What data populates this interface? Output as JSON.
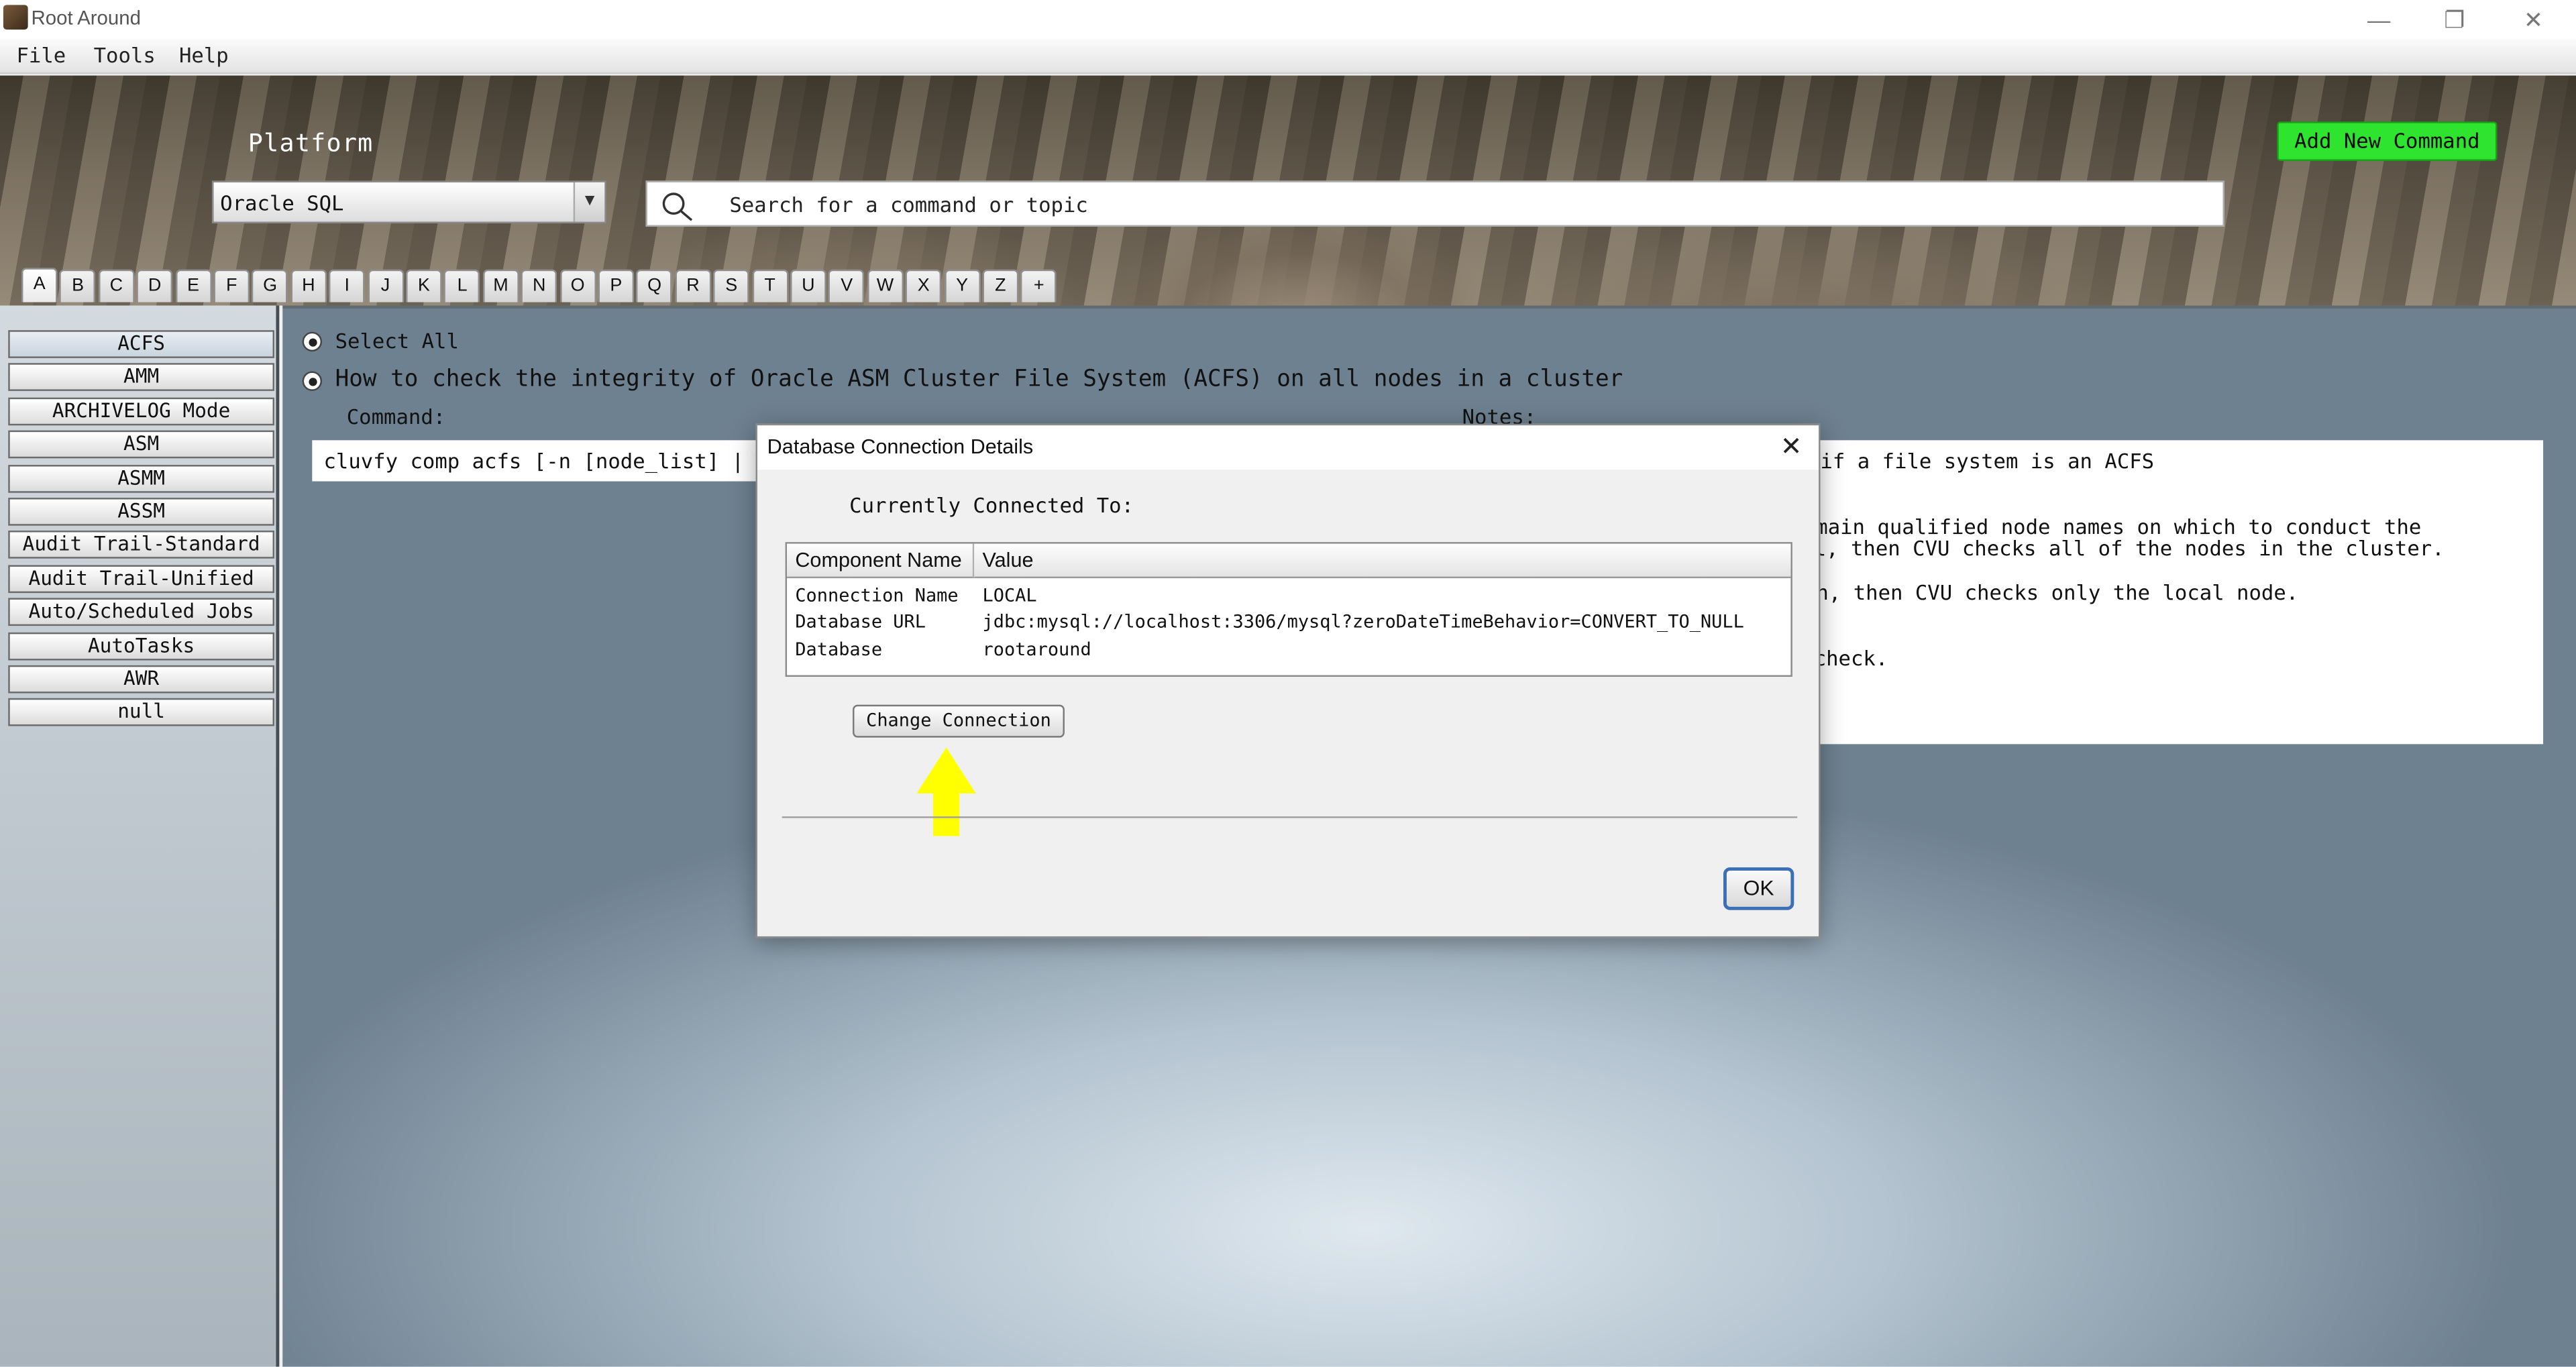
{
  "window": {
    "title": "Root Around",
    "controls": [
      "—",
      "❐",
      "✕"
    ]
  },
  "menu": [
    "File",
    "Tools",
    "Help"
  ],
  "header": {
    "platform_label": "Platform",
    "platform_value": "Oracle SQL",
    "search_placeholder": "Search for a command or topic",
    "add_button": "Add New Command",
    "tabs": [
      "A",
      "B",
      "C",
      "D",
      "E",
      "F",
      "G",
      "H",
      "I",
      "J",
      "K",
      "L",
      "M",
      "N",
      "O",
      "P",
      "Q",
      "R",
      "S",
      "T",
      "U",
      "V",
      "W",
      "X",
      "Y",
      "Z",
      "+"
    ],
    "active_tab": "A"
  },
  "sidebar": {
    "items": [
      "ACFS",
      "AMM",
      "ARCHIVELOG Mode",
      "ASM",
      "ASMM",
      "ASSM",
      "Audit Trail-Standard",
      "Audit Trail-Unified",
      "Auto/Scheduled Jobs",
      "AutoTasks",
      "AWR",
      "null"
    ],
    "active": "ACFS"
  },
  "main": {
    "select_all": "Select All",
    "question": "How to check the integrity of Oracle ASM Cluster File System (ACFS) on all nodes in a cluster",
    "command_label": "Command:",
    "notes_label": "Notes:",
    "command_text": "cluvfy comp acfs [-n [node_list] | [",
    "notes_lines": [
      "if a file system is an ACFS",
      "domain qualified node names on which to conduct the",
      "l, then CVU checks all of the nodes in the cluster.",
      "on, then CVU checks only the local node.",
      "check."
    ]
  },
  "dialog": {
    "title": "Database Connection Details",
    "close": "✕",
    "connected_label": "Currently Connected To:",
    "columns": [
      "Component Name",
      "Value"
    ],
    "rows": [
      {
        "name": "Connection Name",
        "value": "LOCAL"
      },
      {
        "name": "Database URL",
        "value": "jdbc:mysql://localhost:3306/mysql?zeroDateTimeBehavior=CONVERT_TO_NULL"
      },
      {
        "name": "Database",
        "value": "rootaround"
      }
    ],
    "change_button": "Change Connection",
    "ok_button": "OK",
    "annotation_color": "#ffff00"
  },
  "colors": {
    "add_button": "#2fe42f",
    "ok_border": "#3b6fb6"
  }
}
